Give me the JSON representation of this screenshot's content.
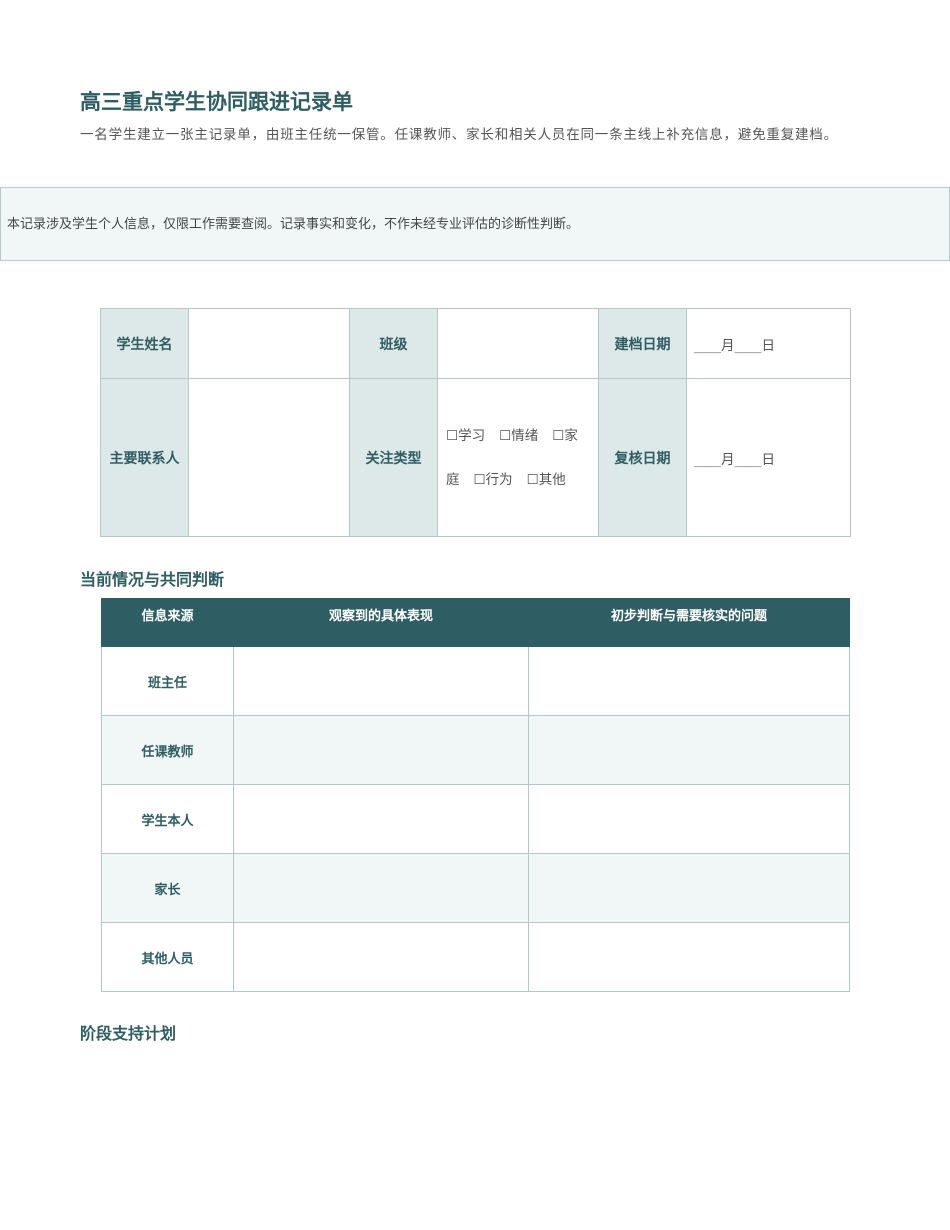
{
  "header": {
    "title": "高三重点学生协同跟进记录单",
    "subtitle": "一名学生建立一张主记录单，由班主任统一保管。任课教师、家长和相关人员在同一条主线上补充信息，避免重复建档。"
  },
  "notice": {
    "text": "本记录涉及学生个人信息，仅限工作需要查阅。记录事实和变化，不作未经专业评估的诊断性判断。"
  },
  "info_table": {
    "student_name_label": "学生姓名",
    "class_label": "班级",
    "created_date_label": "建档日期",
    "created_date_value": "____月____日",
    "contact_label": "主要联系人",
    "focus_type_label": "关注类型",
    "focus_options": [
      "☐学习",
      "☐情绪",
      "☐家庭",
      "☐行为",
      "☐其他"
    ],
    "review_date_label": "复核日期",
    "review_date_value": "____月____日"
  },
  "section_current": {
    "heading": "当前情况与共同判断",
    "columns": [
      "信息来源",
      "观察到的具体表现",
      "初步判断与需要核实的问题"
    ],
    "rows": [
      "班主任",
      "任课教师",
      "学生本人",
      "家长",
      "其他人员"
    ]
  },
  "section_plan": {
    "heading": "阶段支持计划"
  },
  "colors": {
    "accent": "#2e5e63",
    "label_bg": "#dde8e8",
    "stripe_bg": "#f1f7f6",
    "border": "#b5c7c7"
  }
}
